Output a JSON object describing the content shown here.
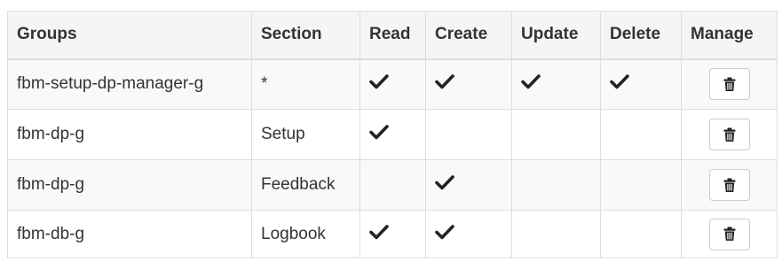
{
  "table": {
    "columns": [
      "Groups",
      "Section",
      "Read",
      "Create",
      "Update",
      "Delete",
      "Manage"
    ],
    "rows": [
      {
        "group": "fbm-setup-dp-manager-g",
        "section": "*",
        "read": true,
        "create": true,
        "update": true,
        "delete": true
      },
      {
        "group": "fbm-dp-g",
        "section": "Setup",
        "read": true,
        "create": false,
        "update": false,
        "delete": false
      },
      {
        "group": "fbm-dp-g",
        "section": "Feedback",
        "read": false,
        "create": true,
        "update": false,
        "delete": false
      },
      {
        "group": "fbm-db-g",
        "section": "Logbook",
        "read": true,
        "create": true,
        "update": false,
        "delete": false
      }
    ],
    "icons": {
      "check": "check-icon",
      "delete": "trash-icon"
    }
  }
}
